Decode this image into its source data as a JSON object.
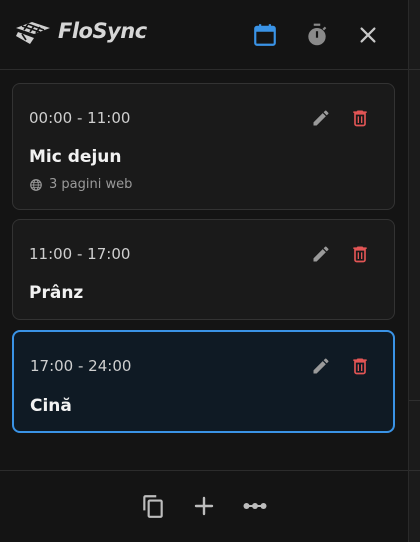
{
  "app": {
    "name": "FloSync"
  },
  "header": {
    "icons": [
      "calendar-icon",
      "timer-icon",
      "close-icon"
    ],
    "accent_color": "#3a93e6"
  },
  "slots": [
    {
      "time": "00:00 - 11:00",
      "title": "Mic dejun",
      "pages": "3 pagini web",
      "selected": false
    },
    {
      "time": "11:00 - 17:00",
      "title": "Prânz",
      "selected": false
    },
    {
      "time": "17:00 - 24:00",
      "title": "Cină",
      "selected": true
    }
  ],
  "actions": {
    "edit_icon": "pencil-icon",
    "delete_icon": "trash-icon",
    "delete_color": "#e25555"
  },
  "footer": {
    "icons": [
      "copy-icon",
      "plus-icon",
      "more-icon"
    ]
  }
}
